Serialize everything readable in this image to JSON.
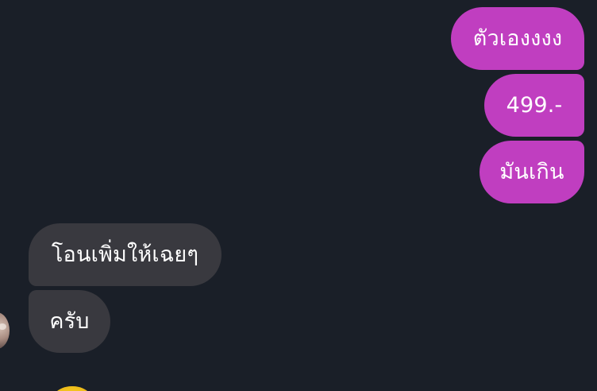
{
  "messages": [
    {
      "direction": "outgoing",
      "text": "ตัวเองงงง"
    },
    {
      "direction": "outgoing",
      "text": "499.-"
    },
    {
      "direction": "outgoing",
      "text": "มันเกิน"
    },
    {
      "direction": "incoming",
      "text": "โอนเพิ่มให้เฉยๆ"
    },
    {
      "direction": "incoming",
      "text": "ครับ"
    }
  ],
  "colors": {
    "background": "#1a1f28",
    "outgoing_bubble": "#c03ec0",
    "incoming_bubble": "#39393f",
    "text": "#ffffff"
  },
  "icons": {
    "sender_avatar": "avatar-photo",
    "emoji_peek": "emoji-face-icon"
  }
}
